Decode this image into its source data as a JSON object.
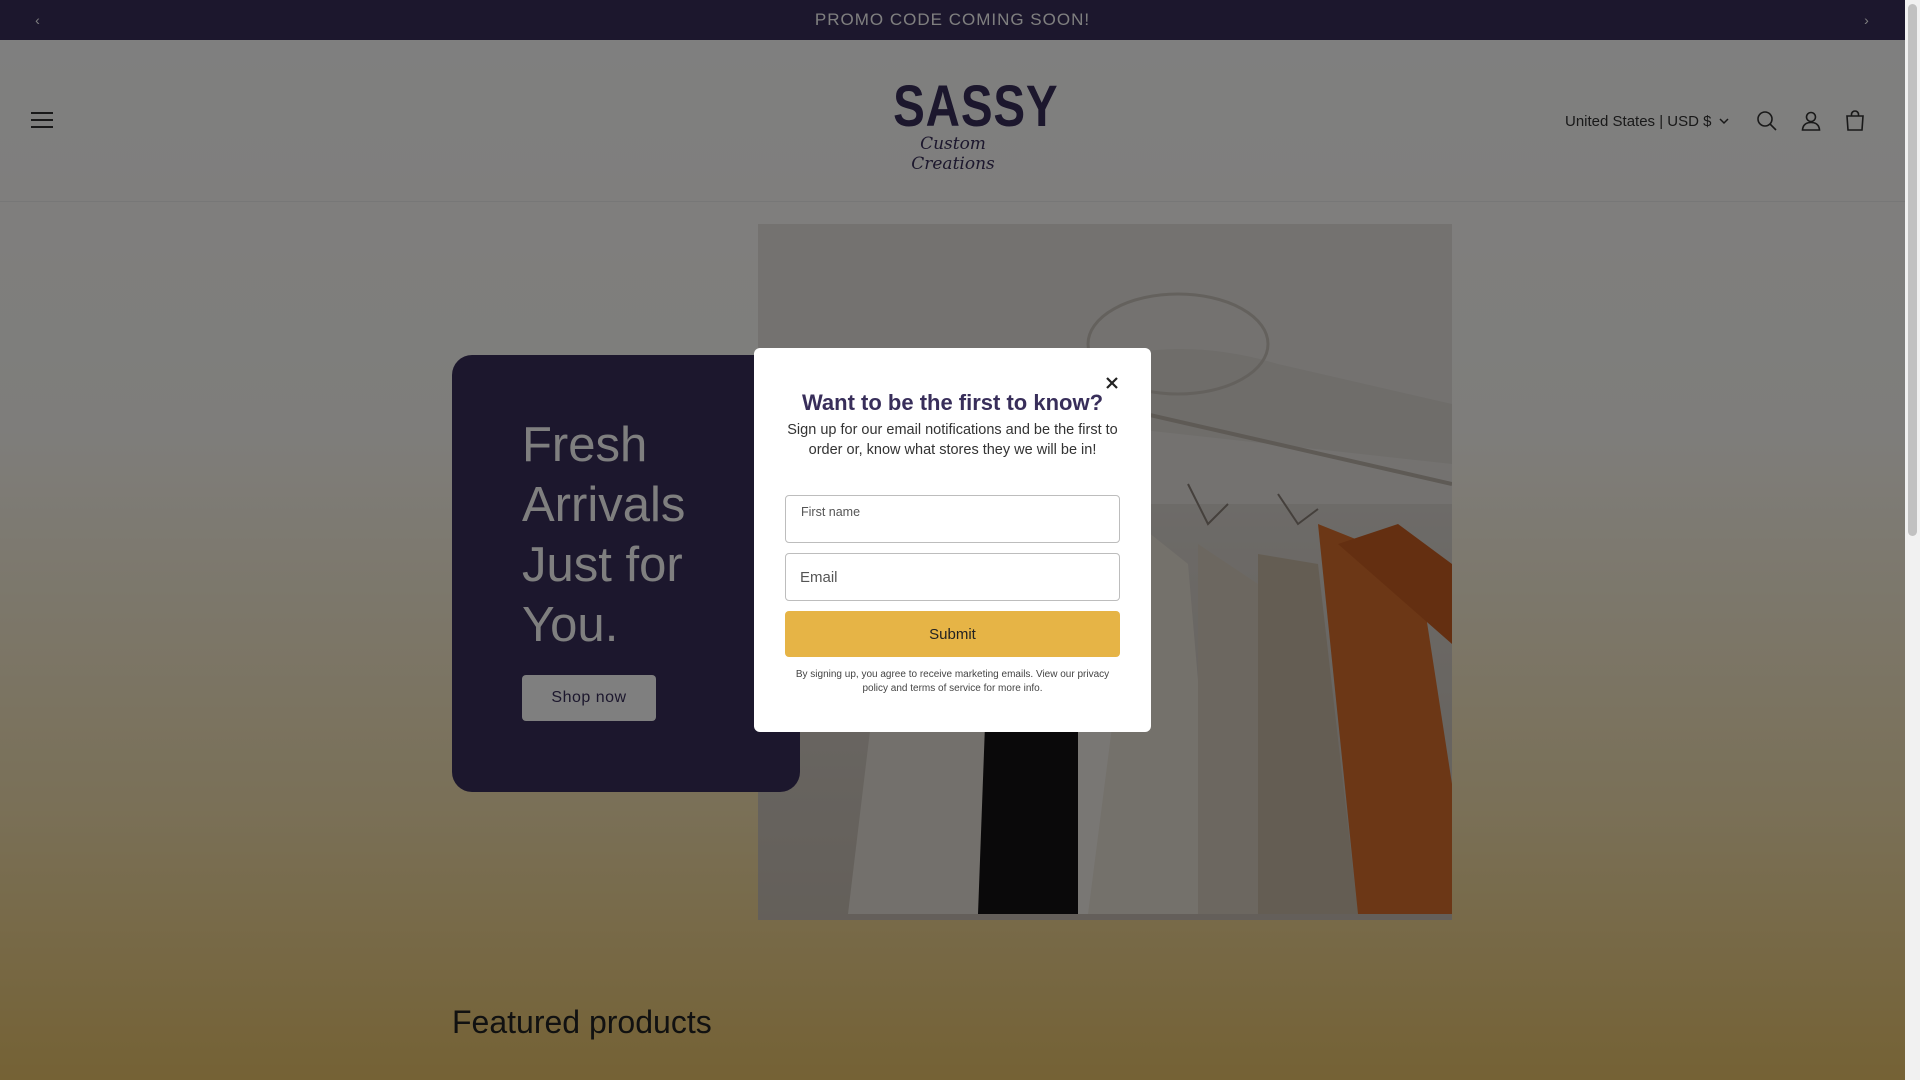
{
  "announcement": {
    "text": "PROMO CODE COMING SOON!"
  },
  "header": {
    "logo_main": "SASSY",
    "logo_script": "Custom Creations",
    "country_selector": "United States | USD $"
  },
  "hero": {
    "title": "Fresh Arrivals Just for You.",
    "button": "Shop now"
  },
  "featured": {
    "heading": "Featured products"
  },
  "popup": {
    "title": "Want to be the first to know?",
    "subtitle": "Sign up for our email notifications and be the first to order or, know what stores they we will be in!",
    "first_name_label": "First name",
    "first_name_value": "",
    "email_placeholder": "Email",
    "email_value": "",
    "submit": "Submit",
    "legal": "By signing up, you agree to receive marketing emails. View our privacy policy and terms of service for more info."
  },
  "colors": {
    "brand": "#382e5a",
    "accent": "#e6b446"
  },
  "icons": [
    "chevron-left-icon",
    "chevron-right-icon",
    "menu-icon",
    "search-icon",
    "account-icon",
    "cart-icon",
    "close-icon",
    "chevron-down-icon"
  ]
}
